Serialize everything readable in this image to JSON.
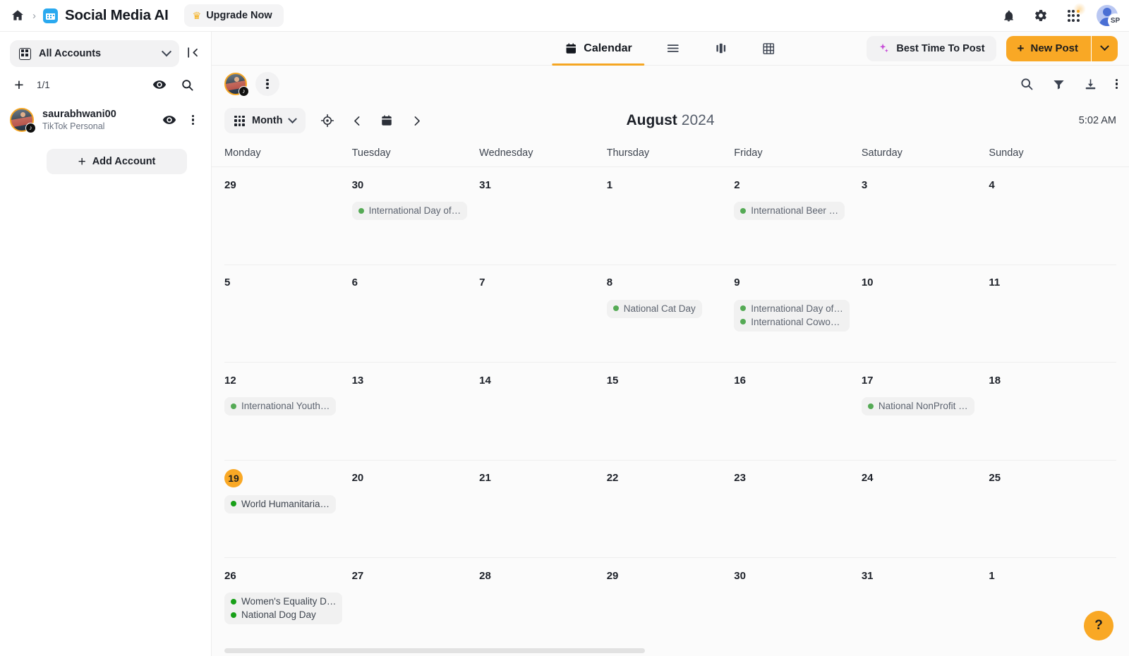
{
  "topbar": {
    "home_icon": "home-icon",
    "breadcrumb_separator": "›",
    "app_icon": "calendar-app-icon",
    "title": "Social Media AI",
    "upgrade_label": "Upgrade Now",
    "crown_icon": "crown-icon",
    "icons": [
      "bell-icon",
      "gear-icon",
      "apps-grid-icon"
    ],
    "avatar_initials": "SP"
  },
  "sidebar": {
    "account_selector_label": "All Accounts",
    "account_selector_icon": "grid-square-icon",
    "collapse_icon": "collapse-panel-icon",
    "add_icon": "plus-icon",
    "count": "1/1",
    "eye_icon": "eye-icon",
    "search_icon": "search-icon",
    "accounts": [
      {
        "name": "saurabhwani00",
        "platform": "TikTok Personal",
        "platform_icon": "tiktok-icon",
        "eye_icon": "eye-icon",
        "menu_icon": "more-vertical-icon"
      }
    ],
    "add_account_label": "Add Account",
    "add_account_icon": "plus-icon"
  },
  "main": {
    "tabs": [
      {
        "label": "Calendar",
        "icon": "calendar-icon",
        "active": true
      },
      {
        "label": "",
        "icon": "list-icon",
        "active": false
      },
      {
        "label": "",
        "icon": "board-icon",
        "active": false
      },
      {
        "label": "",
        "icon": "table-grid-icon",
        "active": false
      }
    ],
    "best_time_label": "Best Time To Post",
    "best_time_icon": "sparkles-icon",
    "new_post_label": "New Post",
    "new_post_icon": "plus-icon",
    "new_post_caret_icon": "chevron-down-icon",
    "accent_color": "#f9a825",
    "strip": {
      "account_avatar": "account-avatar",
      "more_icon": "more-vertical-icon",
      "right_icons": [
        "search-icon",
        "filter-icon",
        "download-icon",
        "more-vertical-icon"
      ]
    },
    "calendar": {
      "view_label": "Month",
      "view_icon": "grid-dots-icon",
      "view_caret_icon": "chevron-down-icon",
      "today_icon": "target-icon",
      "prev_icon": "chevron-left-icon",
      "date_picker_icon": "calendar-icon",
      "next_icon": "chevron-right-icon",
      "month": "August",
      "year": "2024",
      "clock": "5:02 AM",
      "weekdays": [
        "Monday",
        "Tuesday",
        "Wednesday",
        "Thursday",
        "Friday",
        "Saturday",
        "Sunday"
      ],
      "today_day": 19,
      "weeks": [
        [
          {
            "day": "29",
            "other_month": true,
            "events": []
          },
          {
            "day": "30",
            "other_month": true,
            "events": [
              {
                "title": "International Day of…"
              }
            ]
          },
          {
            "day": "31",
            "other_month": true,
            "events": []
          },
          {
            "day": "1",
            "other_month": false,
            "events": []
          },
          {
            "day": "2",
            "other_month": false,
            "events": [
              {
                "title": "International Beer …"
              }
            ]
          },
          {
            "day": "3",
            "other_month": false,
            "events": []
          },
          {
            "day": "4",
            "other_month": false,
            "events": []
          }
        ],
        [
          {
            "day": "5",
            "other_month": false,
            "events": []
          },
          {
            "day": "6",
            "other_month": false,
            "events": []
          },
          {
            "day": "7",
            "other_month": false,
            "events": []
          },
          {
            "day": "8",
            "other_month": false,
            "events": [
              {
                "title": "National Cat Day"
              }
            ]
          },
          {
            "day": "9",
            "other_month": false,
            "events": [
              {
                "title": "International Day of…"
              },
              {
                "title": "International Cowo…"
              }
            ]
          },
          {
            "day": "10",
            "other_month": false,
            "events": []
          },
          {
            "day": "11",
            "other_month": false,
            "events": []
          }
        ],
        [
          {
            "day": "12",
            "other_month": false,
            "events": [
              {
                "title": "International Youth…"
              }
            ]
          },
          {
            "day": "13",
            "other_month": false,
            "events": []
          },
          {
            "day": "14",
            "other_month": false,
            "events": []
          },
          {
            "day": "15",
            "other_month": false,
            "events": []
          },
          {
            "day": "16",
            "other_month": false,
            "events": []
          },
          {
            "day": "17",
            "other_month": false,
            "events": [
              {
                "title": "National NonProfit …"
              }
            ]
          },
          {
            "day": "18",
            "other_month": false,
            "events": []
          }
        ],
        [
          {
            "day": "19",
            "other_month": false,
            "today": true,
            "events": [
              {
                "title": "World Humanitaria…",
                "bright": true
              }
            ]
          },
          {
            "day": "20",
            "other_month": false,
            "events": []
          },
          {
            "day": "21",
            "other_month": false,
            "events": []
          },
          {
            "day": "22",
            "other_month": false,
            "events": []
          },
          {
            "day": "23",
            "other_month": false,
            "events": []
          },
          {
            "day": "24",
            "other_month": false,
            "events": []
          },
          {
            "day": "25",
            "other_month": false,
            "events": []
          }
        ],
        [
          {
            "day": "26",
            "other_month": false,
            "events": [
              {
                "title": "Women's Equality D…",
                "bright": true
              },
              {
                "title": "National Dog Day",
                "bright": true
              }
            ]
          },
          {
            "day": "27",
            "other_month": false,
            "events": []
          },
          {
            "day": "28",
            "other_month": false,
            "events": []
          },
          {
            "day": "29",
            "other_month": false,
            "events": []
          },
          {
            "day": "30",
            "other_month": false,
            "events": []
          },
          {
            "day": "31",
            "other_month": false,
            "events": []
          },
          {
            "day": "1",
            "other_month": true,
            "events": []
          }
        ]
      ]
    },
    "help_label": "?"
  }
}
